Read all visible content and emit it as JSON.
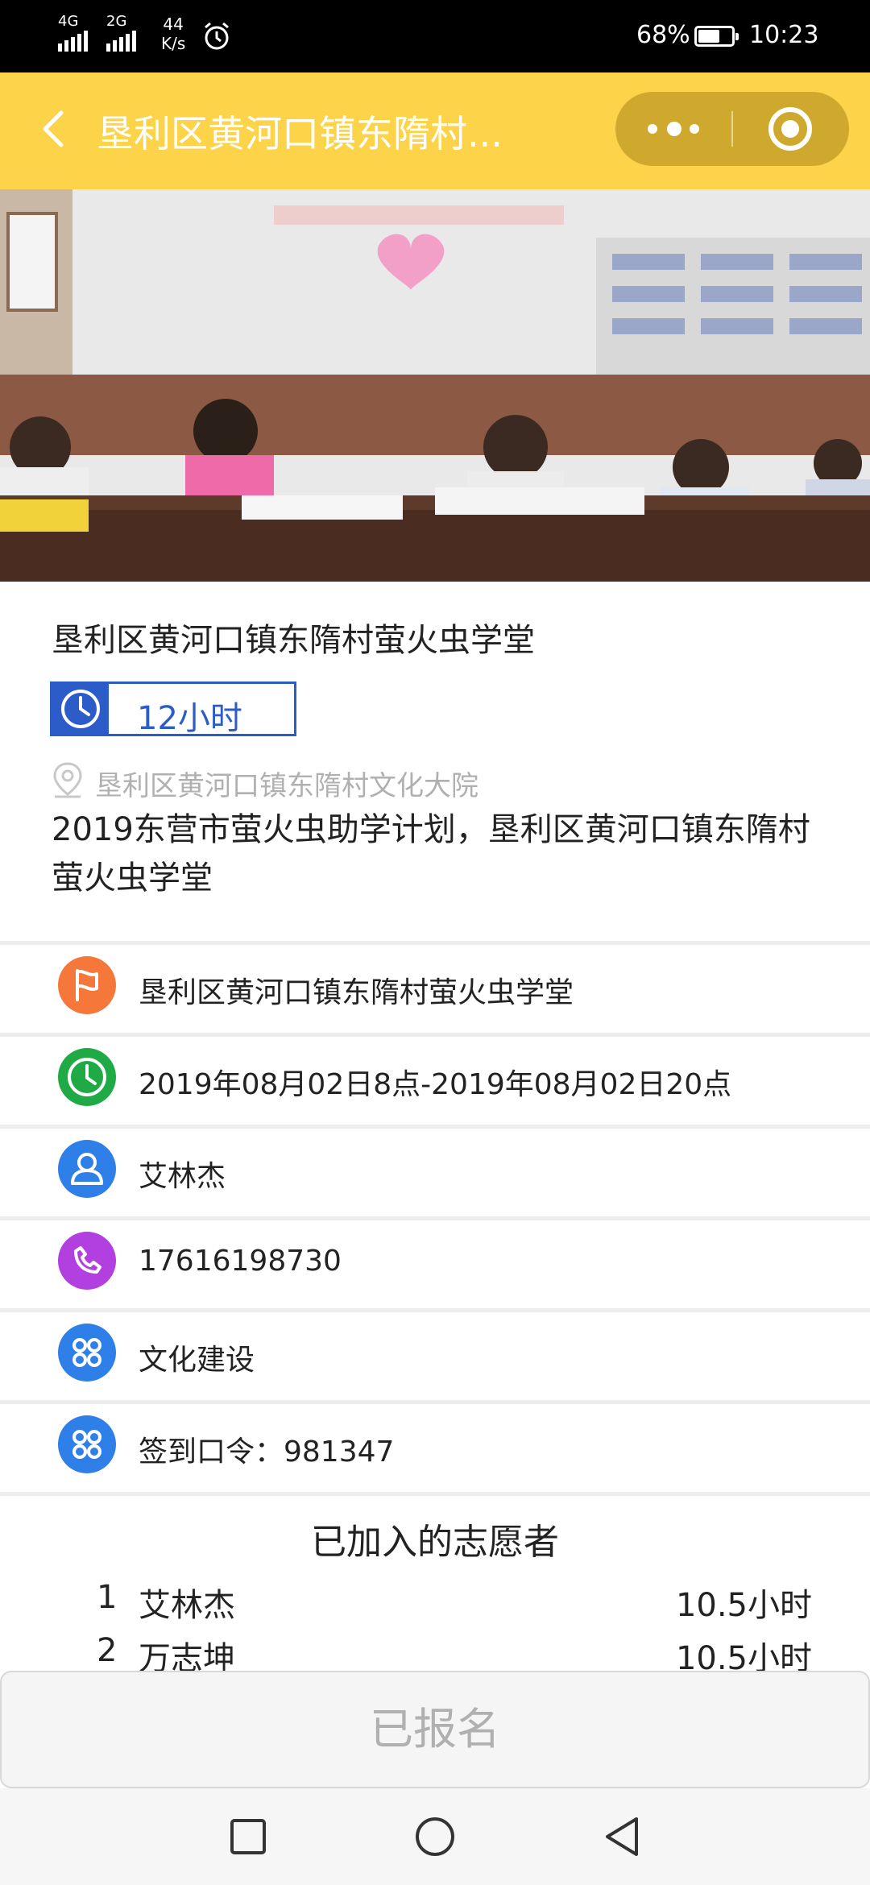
{
  "status_bar": {
    "signal1": "4G",
    "signal2": "2G",
    "speed_value": "44",
    "speed_unit": "K/s",
    "battery": "68%",
    "time": "10:23"
  },
  "header": {
    "title": "垦利区黄河口镇东隋村..."
  },
  "activity": {
    "title": "垦利区黄河口镇东隋村萤火虫学堂",
    "duration": "12小时",
    "location": "垦利区黄河口镇东隋村文化大院",
    "description": "2019东营市萤火虫助学计划，垦利区黄河口镇东隋村萤火虫学堂"
  },
  "details": [
    {
      "icon": "flag-icon",
      "color": "#f5783a",
      "text": "垦利区黄河口镇东隋村萤火虫学堂"
    },
    {
      "icon": "clock-icon",
      "color": "#1faa46",
      "text": "2019年08月02日8点-2019年08月02日20点"
    },
    {
      "icon": "person-icon",
      "color": "#2f7fe8",
      "text": "艾林杰"
    },
    {
      "icon": "phone-icon",
      "color": "#b23fe0",
      "text": "17616198730"
    },
    {
      "icon": "grid-icon",
      "color": "#2f7fe8",
      "text": "文化建设"
    },
    {
      "icon": "grid-icon",
      "color": "#2f7fe8",
      "text": "签到口令：981347"
    }
  ],
  "volunteers": {
    "title": "已加入的志愿者",
    "list": [
      {
        "index": "1",
        "name": "艾林杰",
        "hours": "10.5小时"
      },
      {
        "index": "2",
        "name": "万志坤",
        "hours": "10.5小时"
      }
    ]
  },
  "signup_button": "已报名",
  "colors": {
    "header_bg": "#fdd34a",
    "accent_blue": "#2c5cc7"
  }
}
